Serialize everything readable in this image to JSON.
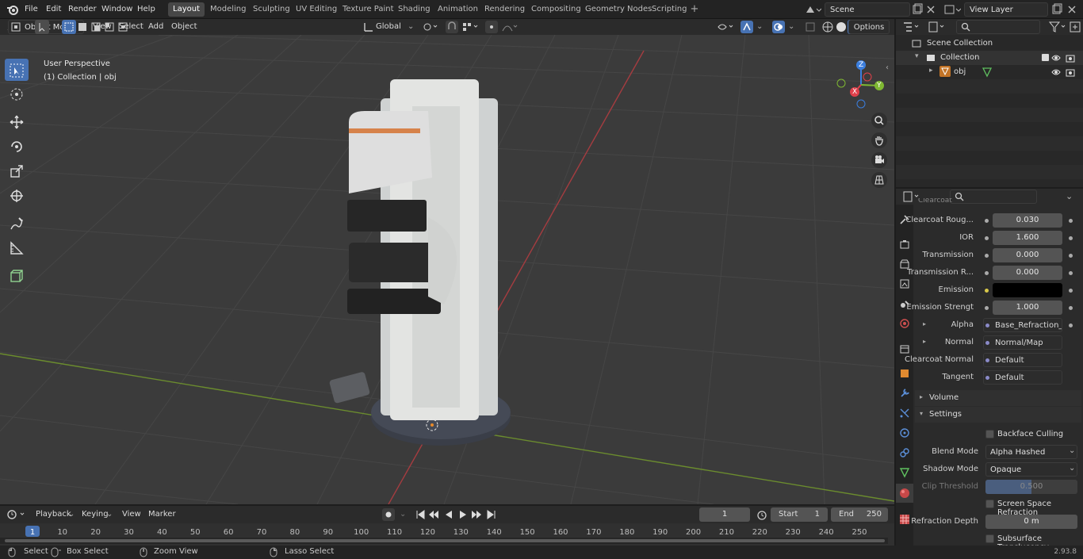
{
  "topbar": {
    "menu": [
      "File",
      "Edit",
      "Render",
      "Window",
      "Help"
    ],
    "workspaces": [
      "Layout",
      "Modeling",
      "Sculpting",
      "UV Editing",
      "Texture Paint",
      "Shading",
      "Animation",
      "Rendering",
      "Compositing",
      "Geometry Nodes",
      "Scripting"
    ],
    "active_workspace": "Layout",
    "scene": "Scene",
    "view_layer": "View Layer"
  },
  "viewport_header": {
    "mode": "Object Mode",
    "menus": [
      "View",
      "Select",
      "Add",
      "Object"
    ],
    "transform_orientation": "Global",
    "options_label": "Options"
  },
  "viewport": {
    "perspective_label": "User Perspective",
    "collection_label": "(1) Collection | obj",
    "gizmo_axes": {
      "x": "X",
      "y": "Y",
      "z": "Z"
    }
  },
  "outliner": {
    "scene_collection": "Scene Collection",
    "collection": "Collection",
    "object": "obj"
  },
  "properties": {
    "clipped_top_label": "Clearcoat",
    "rows": [
      {
        "label": "Clearcoat Roug...",
        "value": "0.030",
        "type": "slider"
      },
      {
        "label": "IOR",
        "value": "1.600",
        "type": "slider"
      },
      {
        "label": "Transmission",
        "value": "0.000",
        "type": "slider"
      },
      {
        "label": "Transmission R...",
        "value": "0.000",
        "type": "slider"
      },
      {
        "label": "Emission",
        "value": "",
        "type": "color"
      },
      {
        "label": "Emission Strengt",
        "value": "1.000",
        "type": "slider"
      },
      {
        "label": "Alpha",
        "value": "Base_Refraction_inv...",
        "type": "link"
      },
      {
        "label": "Normal",
        "value": "Normal/Map",
        "type": "link"
      },
      {
        "label": "Clearcoat Normal",
        "value": "Default",
        "type": "link"
      },
      {
        "label": "Tangent",
        "value": "Default",
        "type": "link"
      }
    ],
    "volume_panel": "Volume",
    "settings_panel": "Settings",
    "backface_culling": "Backface Culling",
    "blend_mode_label": "Blend Mode",
    "blend_mode_value": "Alpha Hashed",
    "shadow_mode_label": "Shadow Mode",
    "shadow_mode_value": "Opaque",
    "clip_threshold_label": "Clip Threshold",
    "clip_threshold_value": "0.500",
    "screen_space_refraction": "Screen Space Refraction",
    "refraction_depth_label": "Refraction Depth",
    "refraction_depth_value": "0 m",
    "subsurface_translucency": "Subsurface Translucency"
  },
  "timeline": {
    "menus": [
      "Playback",
      "Keying",
      "View",
      "Marker"
    ],
    "current_frame": "1",
    "start_label": "Start",
    "start_value": "1",
    "end_label": "End",
    "end_value": "250",
    "ticks": [
      "1",
      "10",
      "20",
      "30",
      "40",
      "50",
      "60",
      "70",
      "80",
      "90",
      "100",
      "110",
      "120",
      "130",
      "140",
      "150",
      "160",
      "170",
      "180",
      "190",
      "200",
      "210",
      "220",
      "230",
      "240",
      "250"
    ]
  },
  "statusbar": {
    "select": "Select",
    "box_select": "Box Select",
    "zoom_view": "Zoom View",
    "lasso_select": "Lasso Select",
    "version": "2.93.8"
  },
  "colors": {
    "accent": "#4772b3",
    "active_tool": "#4772b3",
    "x_axis": "#e0404a",
    "y_axis": "#7fb832",
    "z_axis": "#3b7ede"
  }
}
